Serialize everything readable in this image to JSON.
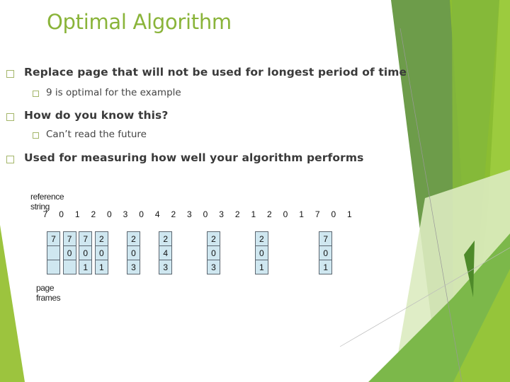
{
  "slide": {
    "title": "Optimal Algorithm",
    "bullets": [
      {
        "level": 1,
        "text": "Replace page that will not be used for longest period of time"
      },
      {
        "level": 2,
        "text": "9 is optimal for the example"
      },
      {
        "level": 1,
        "text": "How do you know this?"
      },
      {
        "level": 2,
        "text": "Can’t read the future"
      },
      {
        "level": 1,
        "text": "Used for measuring how well your algorithm performs"
      }
    ],
    "bullet_icon": "hollow-square-icon",
    "colors": {
      "title": "#8ab43a",
      "text": "#3a3a3a",
      "bullet_border": "#a4b66a",
      "frame_fill": "#cfe7f0",
      "frame_border": "#5c6670",
      "accent_dark_green": "#6a9a45",
      "accent_lime": "#8cbf3a",
      "accent_light_green": "#dcebc0"
    }
  },
  "figure": {
    "reference_label": "reference string",
    "frames_label": "page frames",
    "reference_string": [
      "7",
      "0",
      "1",
      "2",
      "0",
      "3",
      "0",
      "4",
      "2",
      "3",
      "0",
      "3",
      "2",
      "1",
      "2",
      "0",
      "1",
      "7",
      "0",
      "1"
    ],
    "frame_snapshots": [
      {
        "at_index": 0,
        "frames": [
          "7",
          "",
          ""
        ]
      },
      {
        "at_index": 1,
        "frames": [
          "7",
          "0",
          ""
        ]
      },
      {
        "at_index": 2,
        "frames": [
          "7",
          "0",
          "1"
        ]
      },
      {
        "at_index": 3,
        "frames": [
          "2",
          "0",
          "1"
        ]
      },
      {
        "at_index": 5,
        "frames": [
          "2",
          "0",
          "3"
        ]
      },
      {
        "at_index": 7,
        "frames": [
          "2",
          "4",
          "3"
        ]
      },
      {
        "at_index": 10,
        "frames": [
          "2",
          "0",
          "3"
        ]
      },
      {
        "at_index": 13,
        "frames": [
          "2",
          "0",
          "1"
        ]
      },
      {
        "at_index": 17,
        "frames": [
          "7",
          "0",
          "1"
        ]
      }
    ]
  }
}
